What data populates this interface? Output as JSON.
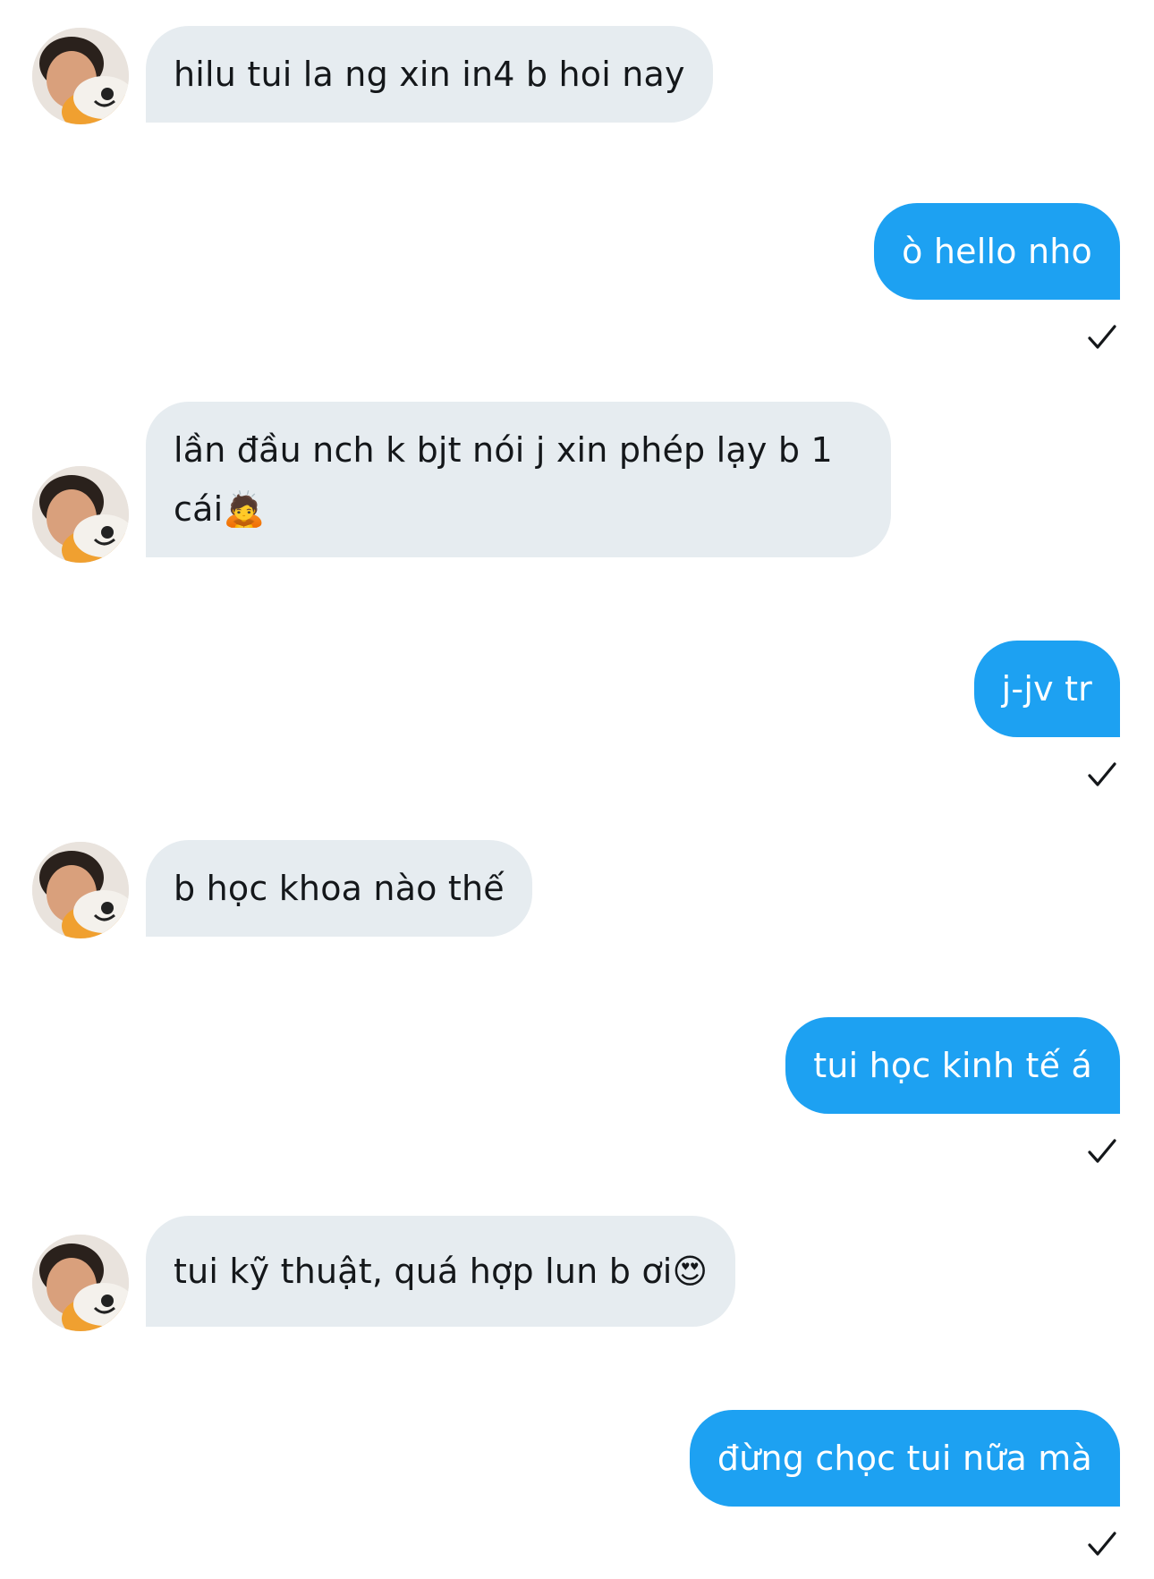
{
  "conversation": {
    "messages": [
      {
        "direction": "incoming",
        "text": "hilu tui la ng xin in4 b hoi nay"
      },
      {
        "direction": "outgoing",
        "text": "ò hello nho",
        "status_icon": "checkmark-icon"
      },
      {
        "direction": "incoming",
        "text": "lần đầu nch k bjt nói j xin phép lạy b 1 cái🙇"
      },
      {
        "direction": "outgoing",
        "text": "j-jv tr",
        "status_icon": "checkmark-icon"
      },
      {
        "direction": "incoming",
        "text": "b học khoa nào thế"
      },
      {
        "direction": "outgoing",
        "text": "tui học kinh tế á",
        "status_icon": "checkmark-icon"
      },
      {
        "direction": "incoming",
        "text": "tui kỹ thuật, quá hợp lun b ơi😍"
      },
      {
        "direction": "outgoing",
        "text": "đừng chọc tui nữa mà",
        "status_icon": "checkmark-icon"
      }
    ]
  },
  "colors": {
    "outgoing_bubble": "#1da1f2",
    "incoming_bubble": "#e6ecf0",
    "incoming_text": "#14171a",
    "outgoing_text": "#ffffff"
  }
}
